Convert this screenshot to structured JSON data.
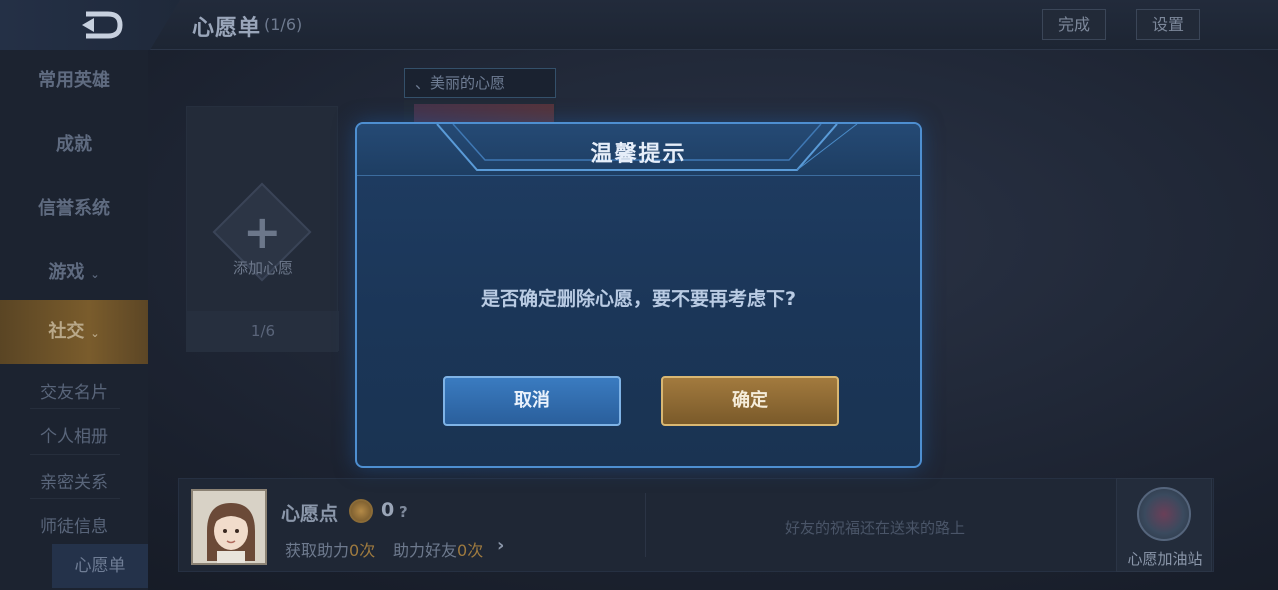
{
  "header": {
    "title": "心愿单",
    "count": "(1/6)",
    "done_label": "完成",
    "settings_label": "设置"
  },
  "sidebar": {
    "items": [
      {
        "label": "常用英雄"
      },
      {
        "label": "成就"
      },
      {
        "label": "信誉系统"
      },
      {
        "label": "游戏",
        "chevron": "⌄"
      },
      {
        "label": "社交",
        "chevron": "⌄",
        "active": true
      }
    ],
    "sub_items": [
      {
        "label": "交友名片"
      },
      {
        "label": "个人相册"
      },
      {
        "label": "亲密关系"
      },
      {
        "label": "师徒信息"
      },
      {
        "label": "心愿单",
        "current": true
      }
    ]
  },
  "wishlist": {
    "add_label": "添加心愿",
    "add_count": "1/6",
    "wish_banner": "、美丽的心愿"
  },
  "bottom": {
    "points_label": "心愿点",
    "points_value": "0",
    "help": "?",
    "assist_get": "获取助力",
    "assist_get_num": "0次",
    "assist_friend": "助力好友",
    "assist_friend_num": "0次",
    "friends_message": "好友的祝福还在送来的路上",
    "station_label": "心愿加油站"
  },
  "dialog": {
    "title": "温馨提示",
    "message": "是否确定删除心愿，要不要再考虑下?",
    "cancel_label": "取消",
    "confirm_label": "确定"
  },
  "icons": {
    "back": "back-arrow-icon",
    "add": "plus-icon",
    "coin": "wish-coin-icon",
    "arrow": "chevron-right-icon",
    "station": "gas-station-icon"
  },
  "colors": {
    "dialog_border": "#4e8fd1",
    "cancel_bg": "#2f6aa8",
    "confirm_bg": "#8e6a34",
    "active_sidebar": "#6f542a",
    "accent_number": "#9e7a3f"
  }
}
